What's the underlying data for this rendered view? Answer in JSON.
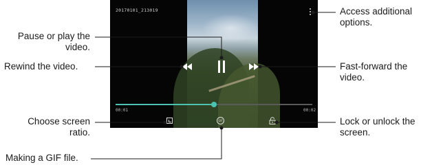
{
  "video": {
    "timestamp": "20170101_213019",
    "time_start": "00:01",
    "time_end": "00:02",
    "progress_fraction": 0.5,
    "gif_glyph": "GIF"
  },
  "callouts": {
    "options": [
      "Access additional",
      "options."
    ],
    "pause": [
      "Pause or play the",
      "video."
    ],
    "rewind": [
      "Rewind the video."
    ],
    "ffwd": [
      "Fast-forward the",
      "video."
    ],
    "ratio": [
      "Choose screen",
      "ratio."
    ],
    "lock": [
      "Lock or unlock the",
      "screen."
    ],
    "gif": [
      "Making a GIF file."
    ]
  },
  "colors": {
    "progress": "#4cc2b0",
    "leader": "#1a1a1a"
  },
  "icons": {
    "options": "more-vertical-icon",
    "pause": "pause-icon",
    "rewind": "rewind-icon",
    "ffwd": "fast-forward-icon",
    "ratio": "screen-ratio-icon",
    "gif": "gif-icon",
    "lock": "lock-icon"
  }
}
